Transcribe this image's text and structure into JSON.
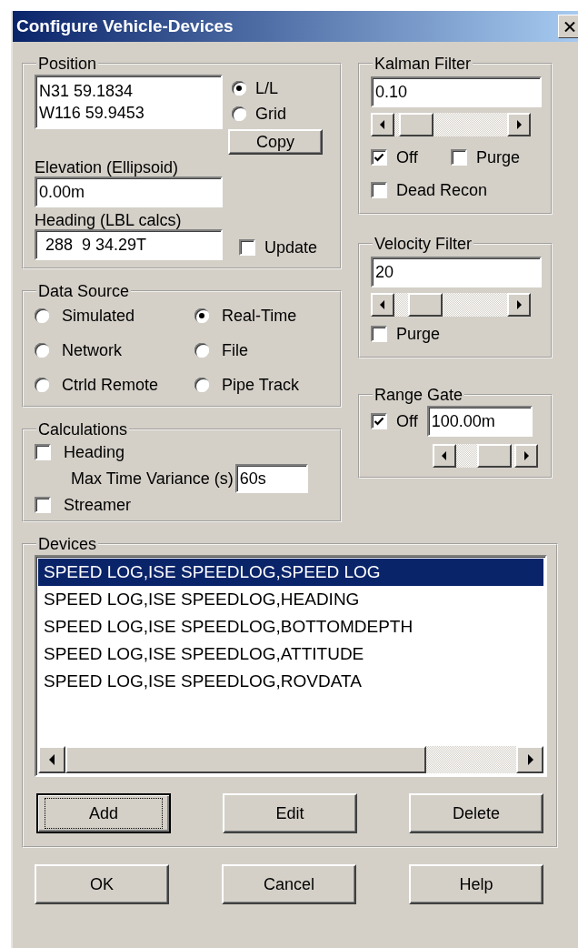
{
  "window": {
    "title": "Configure Vehicle-Devices"
  },
  "position": {
    "label": "Position",
    "coordinates": [
      "N31 59.1834",
      "W116 59.9453"
    ],
    "modes": [
      {
        "label": "L/L",
        "selected": true
      },
      {
        "label": "Grid",
        "selected": false
      }
    ],
    "copy_button": "Copy",
    "elevation_label": "Elevation (Ellipsoid)",
    "elevation": "0.00m",
    "heading_label": "Heading (LBL calcs)",
    "heading": "288  9 34.29T",
    "update": {
      "label": "Update",
      "checked": false
    }
  },
  "kalman_filter": {
    "label": "Kalman Filter",
    "value": "0.10",
    "level": 0.06,
    "options": [
      {
        "label": "Off",
        "checked": true
      },
      {
        "label": "Purge",
        "checked": false
      },
      {
        "label": "Dead Recon",
        "checked": false
      }
    ]
  },
  "velocity_filter": {
    "label": "Velocity Filter",
    "value": "20",
    "level": 0.17,
    "options": [
      {
        "label": "Purge",
        "checked": false
      }
    ]
  },
  "data_source": {
    "label": "Data Source",
    "options": [
      {
        "label": "Simulated",
        "selected": false
      },
      {
        "label": "Real-Time",
        "selected": true
      },
      {
        "label": "Network",
        "selected": false
      },
      {
        "label": "File",
        "selected": false
      },
      {
        "label": "Ctrld Remote",
        "selected": false
      },
      {
        "label": "Pipe Track",
        "selected": false
      }
    ]
  },
  "calculations": {
    "label": "Calculations",
    "heading": {
      "label": "Heading",
      "checked": false
    },
    "variance_label": "Max Time Variance (s)",
    "variance": "60s",
    "streamer": {
      "label": "Streamer",
      "checked": false
    }
  },
  "range_gate": {
    "label": "Range Gate",
    "off": {
      "label": "Off",
      "checked": true
    },
    "value": "100.00m",
    "level": 0.9
  },
  "devices": {
    "label": "Devices",
    "items": [
      {
        "label": "SPEED LOG,ISE SPEEDLOG,SPEED LOG",
        "selected": true
      },
      {
        "label": "SPEED LOG,ISE SPEEDLOG,HEADING",
        "selected": false
      },
      {
        "label": "SPEED LOG,ISE SPEEDLOG,BOTTOMDEPTH",
        "selected": false
      },
      {
        "label": "SPEED LOG,ISE SPEEDLOG,ATTITUDE",
        "selected": false
      },
      {
        "label": "SPEED LOG,ISE SPEEDLOG,ROVDATA",
        "selected": false
      }
    ],
    "buttons": [
      {
        "label": "Add",
        "focused": true
      },
      {
        "label": "Edit",
        "focused": false
      },
      {
        "label": "Delete",
        "focused": false
      }
    ]
  },
  "buttons": [
    "OK",
    "Cancel",
    "Help"
  ]
}
